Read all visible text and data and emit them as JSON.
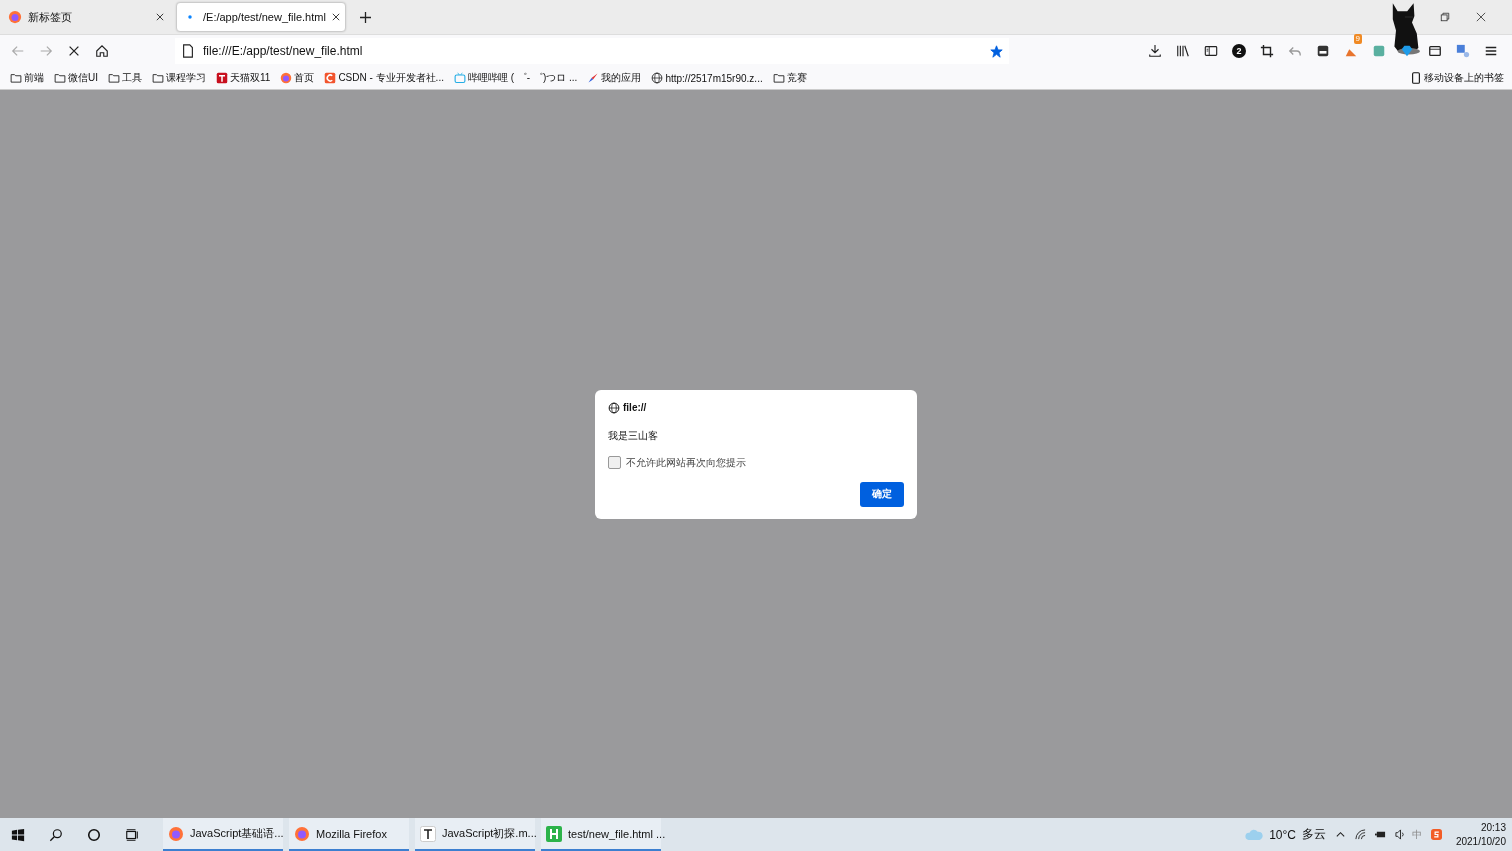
{
  "tabs": [
    {
      "label": "新标签页",
      "selected": false,
      "kind": "firefox"
    },
    {
      "label": "/E:/app/test/new_file.html",
      "selected": true,
      "kind": "loading"
    }
  ],
  "address": {
    "value": "file:///E:/app/test/new_file.html",
    "bookmarked": true
  },
  "toolbar_badges": {
    "counter": "2",
    "notifications": "9"
  },
  "bookmarks": [
    {
      "label": "前端",
      "kind": "folder"
    },
    {
      "label": "微信UI",
      "kind": "folder"
    },
    {
      "label": "工具",
      "kind": "folder"
    },
    {
      "label": "课程学习",
      "kind": "folder"
    },
    {
      "label": "天猫双11",
      "kind": "tmall"
    },
    {
      "label": "首页",
      "kind": "firefox"
    },
    {
      "label": "CSDN - 专业开发者社...",
      "kind": "csdn"
    },
    {
      "label": "哔哩哔哩 ( ゜- ゜)つロ ...",
      "kind": "tv"
    },
    {
      "label": "我的应用",
      "kind": "rocket"
    },
    {
      "label": "http://2517m15r90.z...",
      "kind": "globe"
    },
    {
      "label": "竞赛",
      "kind": "folder"
    }
  ],
  "mobile_bookmarks": "移动设备上的书签",
  "dialog": {
    "origin": "file://",
    "message": "我是三山客",
    "checkbox": {
      "label": "不允许此网站再次向您提示",
      "checked": false
    },
    "button": "确定"
  },
  "taskbar": {
    "apps": [
      {
        "label": "JavaScript基础语...",
        "kind": "firefox",
        "active": true
      },
      {
        "label": "Mozilla Firefox",
        "kind": "firefox",
        "active": true
      },
      {
        "label": "JavaScript初探.m...",
        "kind": "typora",
        "active": true
      },
      {
        "label": "test/new_file.html ...",
        "kind": "hbuilder",
        "active": true
      }
    ],
    "temperature": "10°C",
    "weather": "多云",
    "ime": "中",
    "time": "20:13",
    "date": "2021/10/20"
  }
}
